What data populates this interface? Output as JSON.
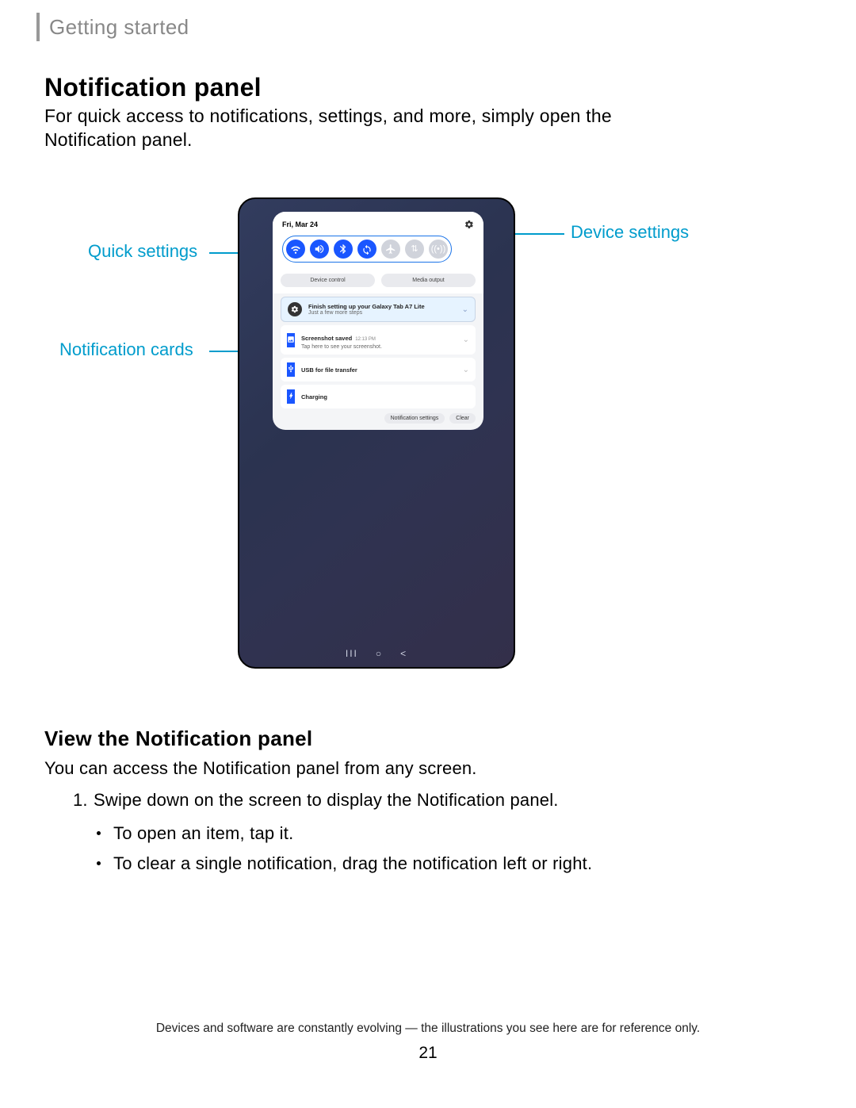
{
  "breadcrumb": "Getting started",
  "title": "Notification panel",
  "lead": "For quick access to notifications, settings, and more, simply open the Notification panel.",
  "callouts": {
    "quick_settings": "Quick settings",
    "notification_cards": "Notification cards",
    "device_settings": "Device settings"
  },
  "device": {
    "date": "Fri, Mar 24",
    "device_control": "Device control",
    "media_output": "Media output",
    "setup": {
      "title": "Finish setting up your Galaxy Tab A7 Lite",
      "sub": "Just a few more steps"
    },
    "screenshot": {
      "title": "Screenshot saved",
      "time": "12:13 PM",
      "sub": "Tap here to see your screenshot."
    },
    "usb": "USB for file transfer",
    "charging": "Charging",
    "notif_settings": "Notification settings",
    "clear": "Clear"
  },
  "section2": {
    "heading": "View the Notification panel",
    "p": "You can access the Notification panel from any screen.",
    "step": "Swipe down on the screen to display the Notification panel.",
    "bullet1": "To open an item, tap it.",
    "bullet2": "To clear a single notification, drag the notification left or right."
  },
  "footer": "Devices and software are constantly evolving — the illustrations you see here are for reference only.",
  "page": "21"
}
